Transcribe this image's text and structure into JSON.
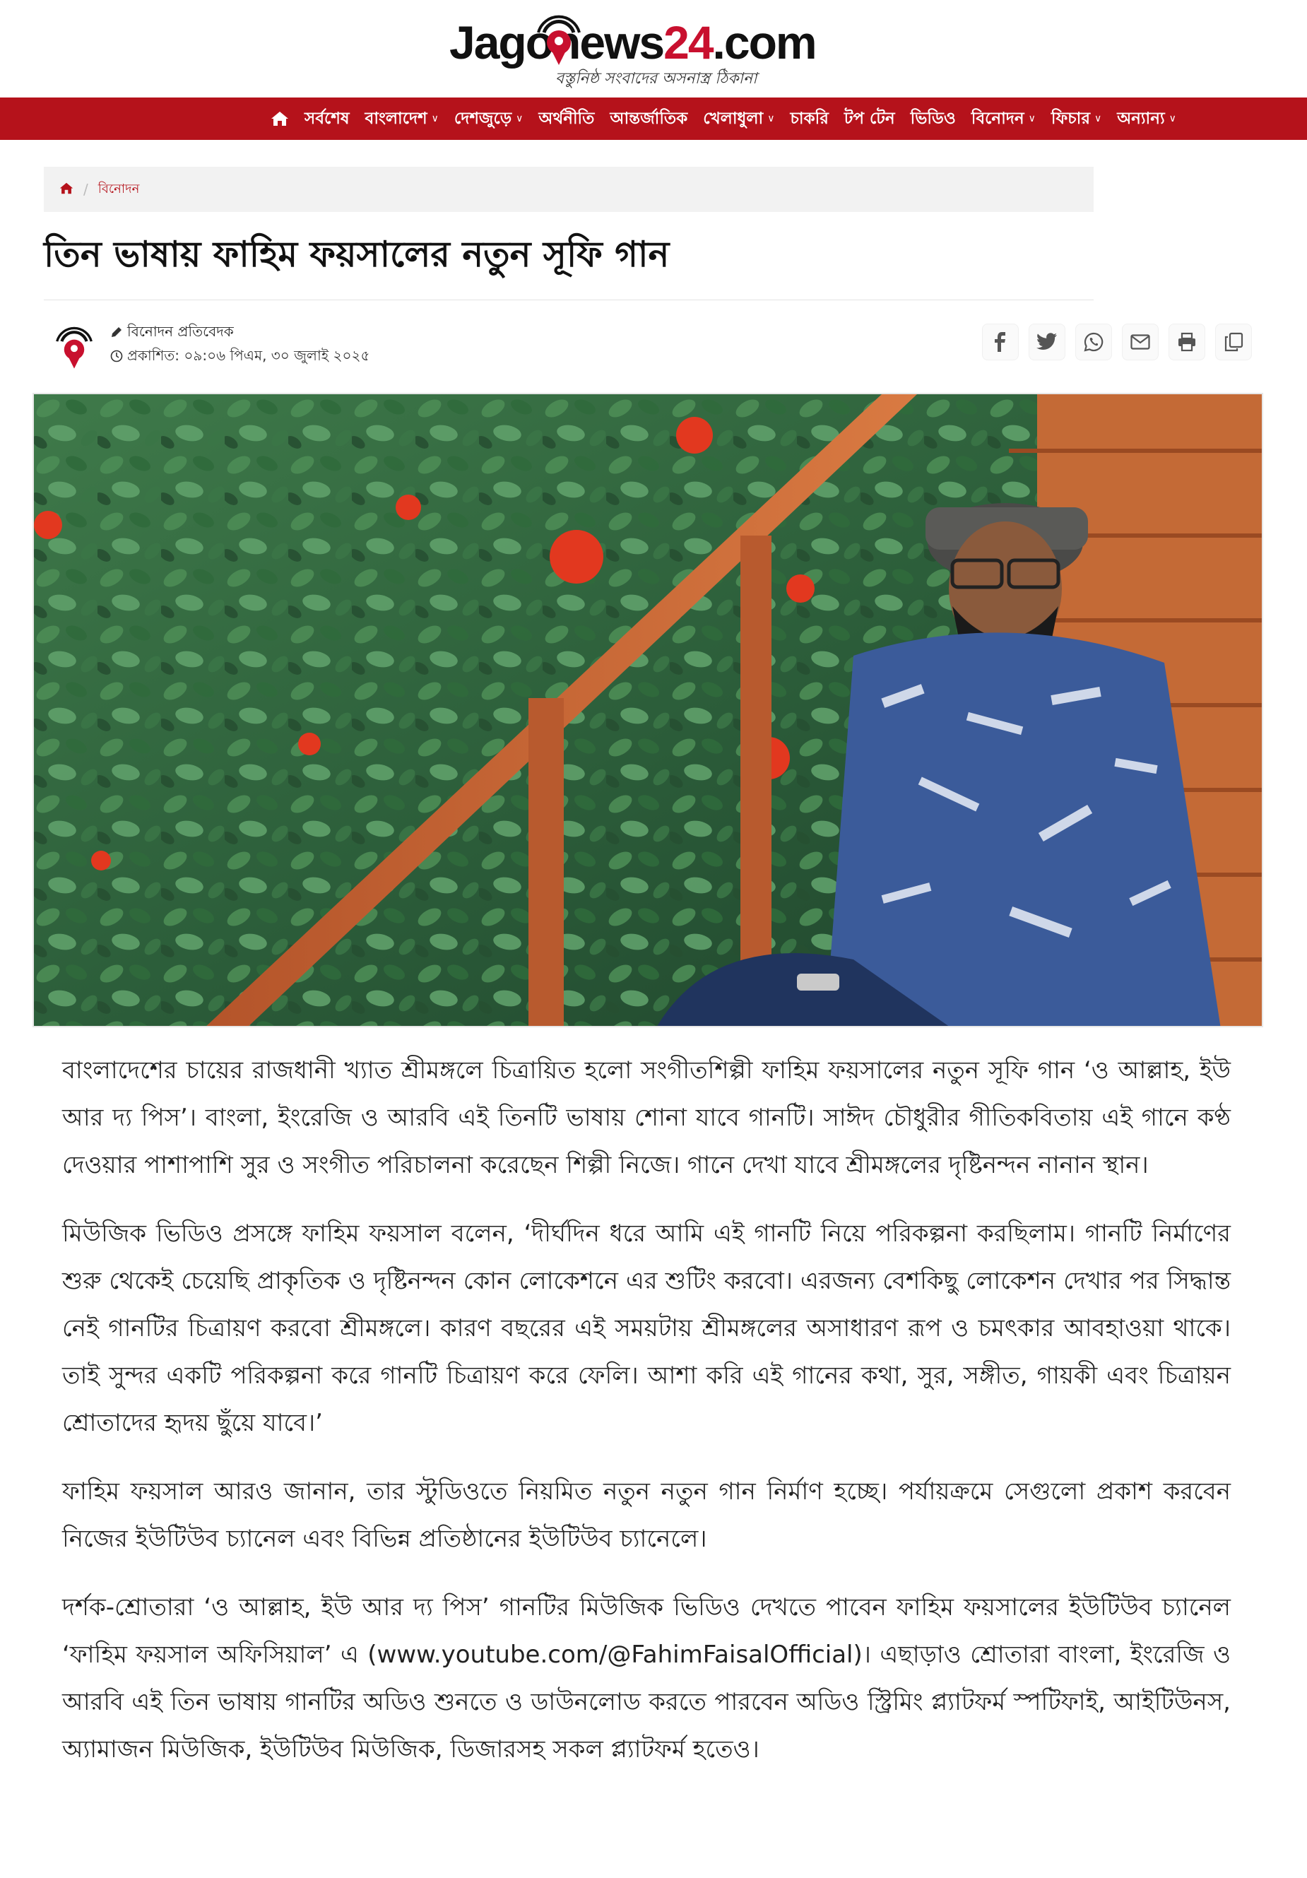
{
  "site": {
    "logo_jago": "Jago",
    "logo_news": "news",
    "logo_24": "24",
    "logo_com": ".com",
    "tagline": "বস্তুনিষ্ঠ সংবাদের অসনাস্ত্র ঠিকানা",
    "brand_color": "#b5121b"
  },
  "nav": {
    "home_icon": "home-icon",
    "items": [
      {
        "label": "সর্বশেষ",
        "dropdown": false
      },
      {
        "label": "বাংলাদেশ",
        "dropdown": true
      },
      {
        "label": "দেশজুড়ে",
        "dropdown": true
      },
      {
        "label": "অর্থনীতি",
        "dropdown": false
      },
      {
        "label": "আন্তর্জাতিক",
        "dropdown": false
      },
      {
        "label": "খেলাধুলা",
        "dropdown": true
      },
      {
        "label": "চাকরি",
        "dropdown": false
      },
      {
        "label": "টপ টেন",
        "dropdown": false
      },
      {
        "label": "ভিডিও",
        "dropdown": false
      },
      {
        "label": "বিনোদন",
        "dropdown": true
      },
      {
        "label": "ফিচার",
        "dropdown": true
      },
      {
        "label": "অন্যান্য",
        "dropdown": true
      }
    ]
  },
  "breadcrumb": {
    "separator": "/",
    "current": "বিনোদন"
  },
  "article": {
    "title": "তিন ভাষায় ফাহিম ফয়সালের নতুন সূফি গান",
    "author": "বিনোদন প্রতিবেদক",
    "published": "প্রকাশিত: ০৯:০৬ পিএম, ৩০ জুলাই ২০২৫",
    "paragraphs": [
      "বাংলাদেশের চায়ের রাজধানী খ্যাত শ্রীমঙ্গলে চিত্রায়িত হলো সংগীতশিল্পী ফাহিম ফয়সালের নতুন সূফি গান ‘ও আল্লাহ, ইউ আর দ্য পিস’। বাংলা, ইংরেজি ও আরবি এই তিনটি ভাষায় শোনা যাবে গানটি। সাঈদ চৌধুরীর গীতিকবিতায় এই গানে কণ্ঠ দেওয়ার পাশাপাশি সুর ও সংগীত পরিচালনা করেছেন শিল্পী নিজে। গানে দেখা যাবে শ্রীমঙ্গলের দৃষ্টিনন্দন নানান স্থান।",
      "মিউজিক ভিডিও প্রসঙ্গে ফাহিম ফয়সাল বলেন, ‘দীর্ঘদিন ধরে আমি এই গানটি নিয়ে পরিকল্পনা করছিলাম। গানটি নির্মাণের শুরু থেকেই চেয়েছি প্রাকৃতিক ও দৃষ্টিনন্দন কোন লোকেশনে এর শুটিং করবো। এরজন্য বেশকিছু লোকেশন দেখার পর সিদ্ধান্ত নেই গানটির চিত্রায়ণ করবো শ্রীমঙ্গলে। কারণ বছরের এই সময়টায় শ্রীমঙ্গলের অসাধারণ রূপ ও চমৎকার আবহাওয়া থাকে। তাই সুন্দর একটি পরিকল্পনা করে গানটি চিত্রায়ণ করে ফেলি। আশা করি এই গানের কথা, সুর, সঙ্গীত, গায়কী এবং চিত্রায়ন শ্রোতাদের হৃদয় ছুঁয়ে যাবে।’",
      "ফাহিম ফয়সাল আরও জানান, তার স্টুডিওতে নিয়মিত নতুন নতুন গান নির্মাণ হচ্ছে। পর্যায়ক্রমে সেগুলো প্রকাশ করবেন নিজের ইউটিউব চ্যানেল এবং বিভিন্ন প্রতিষ্ঠানের ইউটিউব চ্যানেলে।",
      "দর্শক-শ্রোতারা ‘ও আল্লাহ, ইউ আর দ্য পিস’ গানটির মিউজিক ভিডিও দেখতে পাবেন ফাহিম ফয়সালের ইউটিউব চ্যানেল ‘ফাহিম ফয়সাল অফিসিয়াল’ এ (www.youtube.com/@FahimFaisalOfficial)। এছাড়াও শ্রোতারা বাংলা, ইংরেজি ও আরবি এই তিন ভাষায় গানটির অডিও শুনতে ও ডাউনলোড করতে পারবেন অডিও স্ট্রিমিং প্ল্যাটফর্ম স্পটিফাই, আইটিউনস, অ্যামাজন মিউজিক, ইউটিউব মিউজিক, ডিজারসহ সকল প্ল্যাটফর্ম হতেও।"
    ]
  },
  "share": [
    "facebook-icon",
    "twitter-icon",
    "whatsapp-icon",
    "email-icon",
    "print-icon",
    "copy-icon"
  ]
}
